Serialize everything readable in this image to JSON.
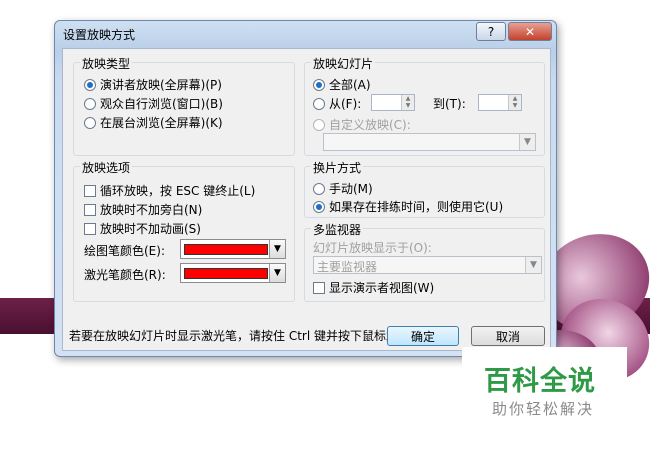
{
  "dialog": {
    "title": "设置放映方式",
    "help_label": "?",
    "close_label": "✕"
  },
  "show_type": {
    "label": "放映类型",
    "options": [
      {
        "label": "演讲者放映(全屏幕)(P)",
        "selected": true
      },
      {
        "label": "观众自行浏览(窗口)(B)",
        "selected": false
      },
      {
        "label": "在展台浏览(全屏幕)(K)",
        "selected": false
      }
    ]
  },
  "slides": {
    "label": "放映幻灯片",
    "all_label": "全部(A)",
    "from_label": "从(F):",
    "to_label": "到(T):",
    "custom_label": "自定义放映(C):"
  },
  "show_options": {
    "label": "放映选项",
    "loop_label": "循环放映，按 ESC 键终止(L)",
    "no_narration_label": "放映时不加旁白(N)",
    "no_animation_label": "放映时不加动画(S)",
    "pen_color_label": "绘图笔颜色(E):",
    "laser_color_label": "激光笔颜色(R):",
    "pen_color": "#ff0000",
    "laser_color": "#ff0000"
  },
  "advance": {
    "label": "换片方式",
    "manual_label": "手动(M)",
    "timings_label": "如果存在排练时间，则使用它(U)",
    "selected": "timings"
  },
  "monitors": {
    "label": "多监视器",
    "display_on_label": "幻灯片放映显示于(O):",
    "display_value": "主要监视器",
    "presenter_view_label": "显示演示者视图(W)"
  },
  "hint": "若要在放映幻灯片时显示激光笔，请按住 Ctrl 键并按下鼠标左按钮。",
  "buttons": {
    "ok": "确定",
    "cancel": "取消"
  },
  "watermark": {
    "logo": "百科全说",
    "sub": "助你轻松解决"
  }
}
